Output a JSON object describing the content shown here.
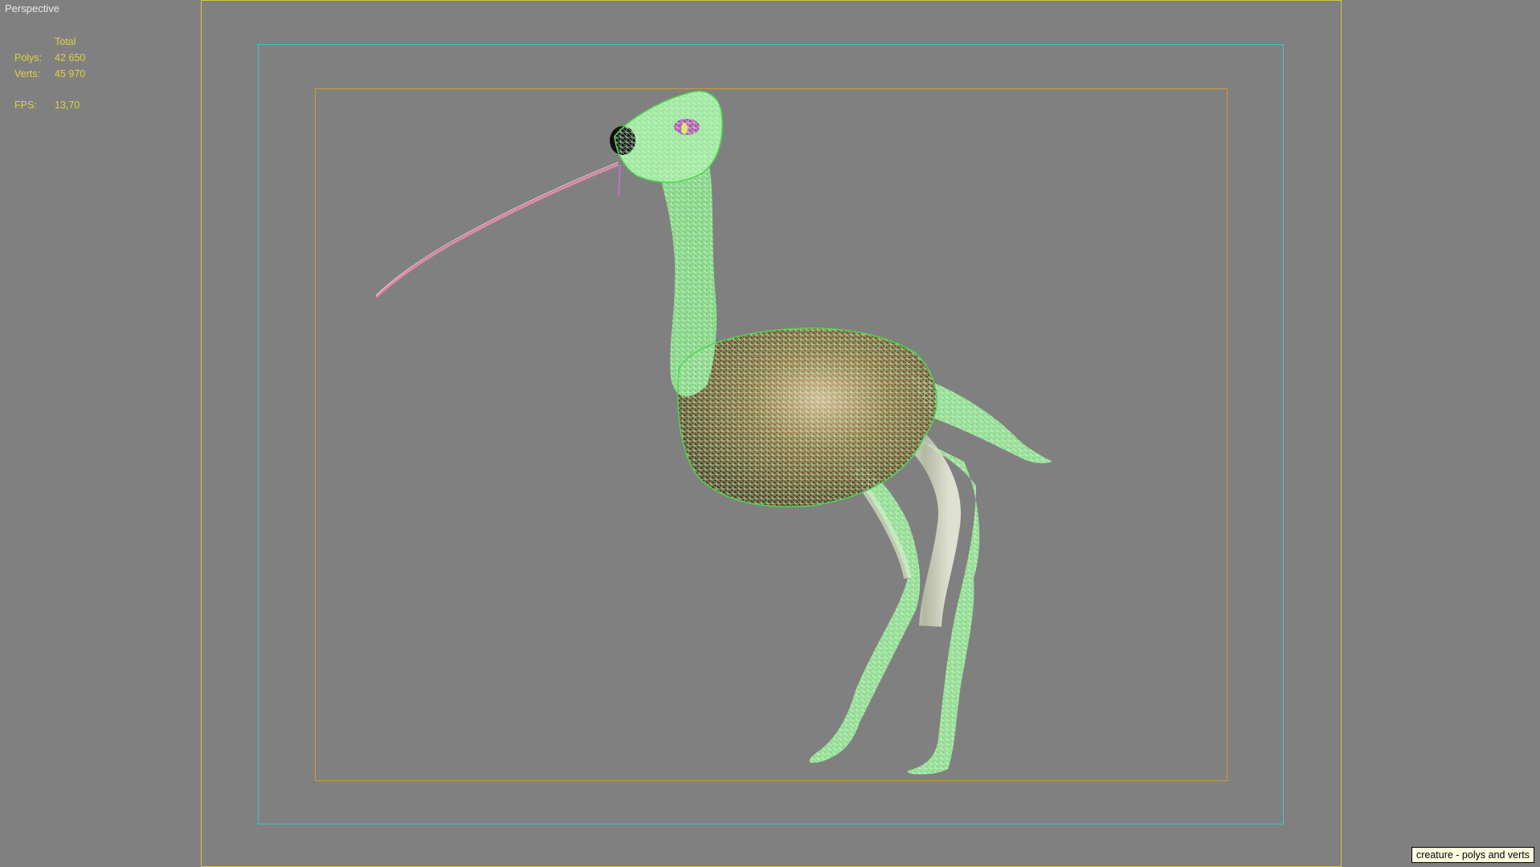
{
  "viewport": {
    "label": "Perspective"
  },
  "stats": {
    "column_header": "Total",
    "rows": [
      {
        "label": "Polys:",
        "value": "42 650"
      },
      {
        "label": "Verts:",
        "value": "45 970"
      }
    ],
    "fps_label": "FPS:",
    "fps_value": "13,70"
  },
  "tooltip": {
    "text": "creature - polys and verts"
  },
  "colors": {
    "viewport_bg": "#808080",
    "wireframe": "#9be59b",
    "safe_frame_outer": "#d4c83a",
    "safe_frame_action": "#39c4d0",
    "safe_frame_title": "#d19a2f",
    "stats_text": "#e0d040"
  }
}
